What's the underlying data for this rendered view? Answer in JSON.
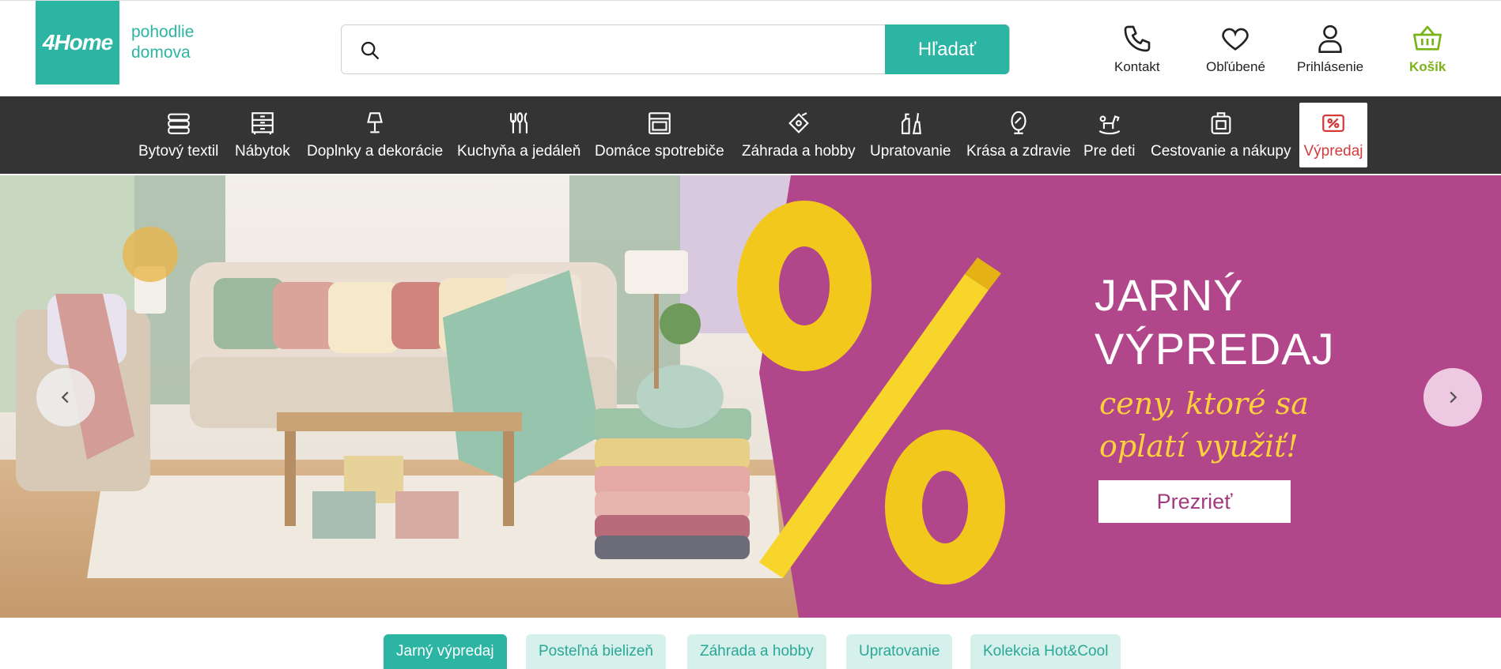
{
  "brand": {
    "logo_text": "4Home",
    "tagline_line1": "pohodlie",
    "tagline_line2": "domova",
    "accent_color": "#2bb5a2"
  },
  "search": {
    "placeholder": "",
    "button_label": "Hľadať"
  },
  "header_actions": [
    {
      "label": "Kontakt",
      "icon": "phone-icon"
    },
    {
      "label": "Obľúbené",
      "icon": "heart-icon"
    },
    {
      "label": "Prihlásenie",
      "icon": "user-icon"
    },
    {
      "label": "Košík",
      "icon": "basket-icon"
    }
  ],
  "nav": {
    "items": [
      {
        "label": "Bytový textil",
        "icon": "towels-icon"
      },
      {
        "label": "Nábytok",
        "icon": "dresser-icon"
      },
      {
        "label": "Doplnky a dekorácie",
        "icon": "lamp-icon"
      },
      {
        "label": "Kuchyňa a jedáleň",
        "icon": "cutlery-icon"
      },
      {
        "label": "Domáce spotrebiče",
        "icon": "oven-icon"
      },
      {
        "label": "Záhrada a hobby",
        "icon": "garden-icon"
      },
      {
        "label": "Upratovanie",
        "icon": "cleaning-icon"
      },
      {
        "label": "Krása a zdravie",
        "icon": "mirror-icon"
      },
      {
        "label": "Pre deti",
        "icon": "rocking-horse-icon"
      },
      {
        "label": "Cestovanie a nákupy",
        "icon": "suitcase-icon"
      },
      {
        "label": "Výpredaj",
        "icon": "sale-tag-icon"
      }
    ]
  },
  "hero": {
    "title_line1": "JARNÝ",
    "title_line2": "VÝPREDAJ",
    "subtitle_line1": "ceny, ktoré sa",
    "subtitle_line2": "oplatí využiť!",
    "button_label": "Prezrieť",
    "background_color": "#b1468a",
    "highlight_color": "#ffd23c"
  },
  "chips": [
    {
      "label": "Jarný výpredaj",
      "active": true
    },
    {
      "label": "Posteľná bielizeň",
      "active": false
    },
    {
      "label": "Záhrada a hobby",
      "active": false
    },
    {
      "label": "Upratovanie",
      "active": false
    },
    {
      "label": "Kolekcia Hot&Cool",
      "active": false
    }
  ]
}
